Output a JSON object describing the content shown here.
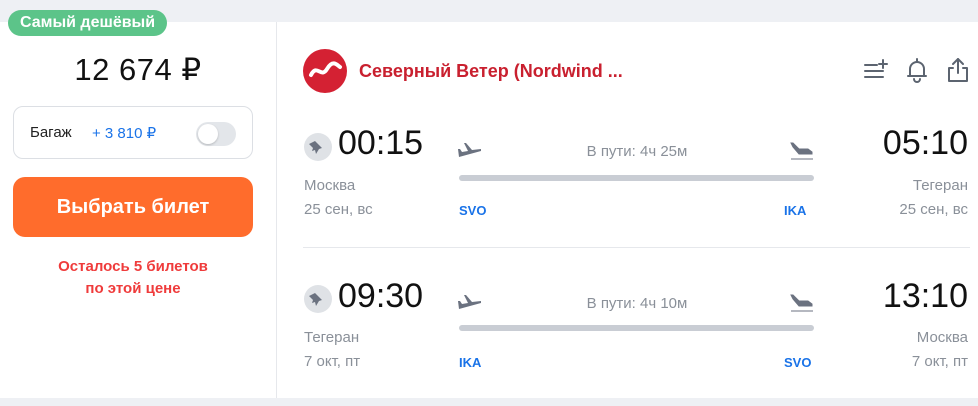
{
  "colors": {
    "badge": "#5cc489",
    "buy_button": "#ff6c2c",
    "airline": "#c9202f",
    "iata": "#1a73e8",
    "remaining": "#ef3b3b"
  },
  "offer": {
    "badge": "Самый дешёвый",
    "price": "12 674 ₽",
    "baggage_label": "Багаж",
    "baggage_price": "+ 3 810 ₽",
    "buy_label": "Выбрать билет",
    "remaining_line1": "Осталось 5 билетов",
    "remaining_line2": "по этой цене"
  },
  "airline": {
    "name": "Северный Ветер (Nordwind ...",
    "icons": [
      "filter-add-icon",
      "bell-icon",
      "share-icon"
    ]
  },
  "segments": [
    {
      "depart_time": "00:15",
      "depart_city": "Москва",
      "depart_date": "25 сен, вс",
      "depart_code": "SVO",
      "duration": "В пути: 4ч 25м",
      "arrive_time": "05:10",
      "arrive_city": "Тегеран",
      "arrive_date": "25 сен, вс",
      "arrive_code": "IKA"
    },
    {
      "depart_time": "09:30",
      "depart_city": "Тегеран",
      "depart_date": "7 окт, пт",
      "depart_code": "IKA",
      "duration": "В пути: 4ч 10м",
      "arrive_time": "13:10",
      "arrive_city": "Москва",
      "arrive_date": "7 окт, пт",
      "arrive_code": "SVO"
    }
  ]
}
